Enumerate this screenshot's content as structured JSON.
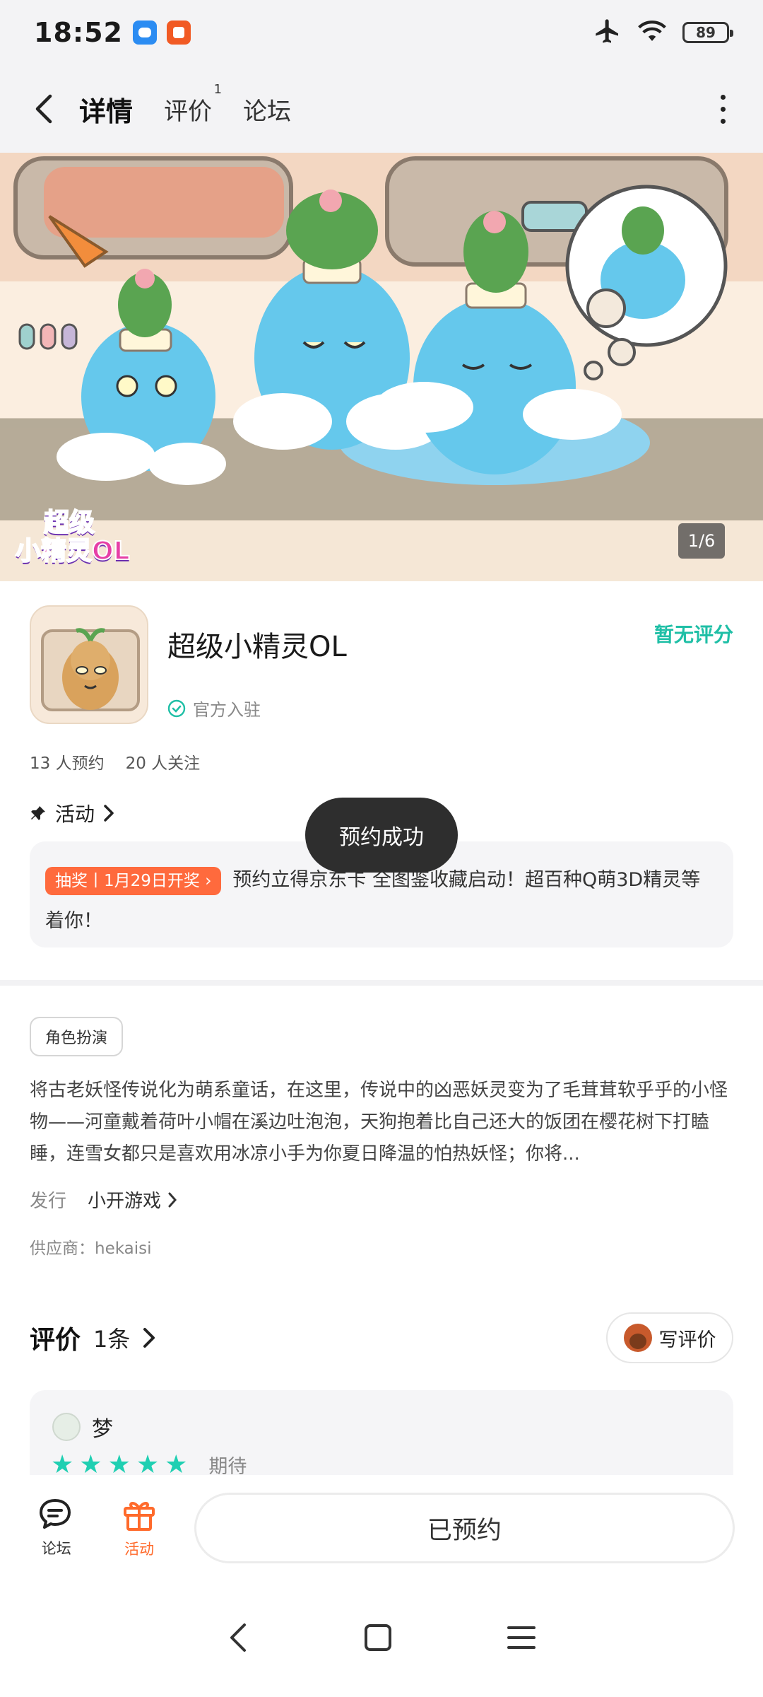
{
  "status_bar": {
    "time": "18:52",
    "battery": "89"
  },
  "nav": {
    "tabs": [
      {
        "label": "详情",
        "active": true
      },
      {
        "label": "评价",
        "badge": "1"
      },
      {
        "label": "论坛"
      }
    ]
  },
  "banner": {
    "counter": "1/6",
    "logo_line1": "超级",
    "logo_line2": "小精灵OL"
  },
  "game": {
    "title": "超级小精灵OL",
    "verified": "官方入驻",
    "rating_status": "暂无评分",
    "reservations": "13 人预约",
    "followers": "20 人关注"
  },
  "activity": {
    "title": "活动",
    "tag": "抽奖丨1月29日开奖 ›",
    "text": "预约立得京东卡 全图鉴收藏启动！超百种Q萌3D精灵等着你！"
  },
  "toast": "预约成功",
  "details": {
    "genre": "角色扮演",
    "description": "将古老妖怪传说化为萌系童话，在这里，传说中的凶恶妖灵变为了毛茸茸软乎乎的小怪物——河童戴着荷叶小帽在溪边吐泡泡，天狗抱着比自己还大的饭团在樱花树下打瞌睡，连雪女都只是喜欢用冰凉小手为你夏日降温的怕热妖怪；你将...",
    "publisher_label": "发行",
    "publisher_name": "小开游戏",
    "supplier": "供应商：hekaisi"
  },
  "reviews": {
    "title": "评价",
    "count": "1条",
    "write_button": "写评价",
    "items": [
      {
        "user": "梦",
        "stars": 5,
        "label": "期待"
      }
    ]
  },
  "bottom_bar": {
    "forum_label": "论坛",
    "activity_label": "活动",
    "reserve_button": "已预约"
  },
  "colors": {
    "accent": "#1fbfa6",
    "tab_underline": "#2fd1b8",
    "orange": "#ff6a3d"
  }
}
